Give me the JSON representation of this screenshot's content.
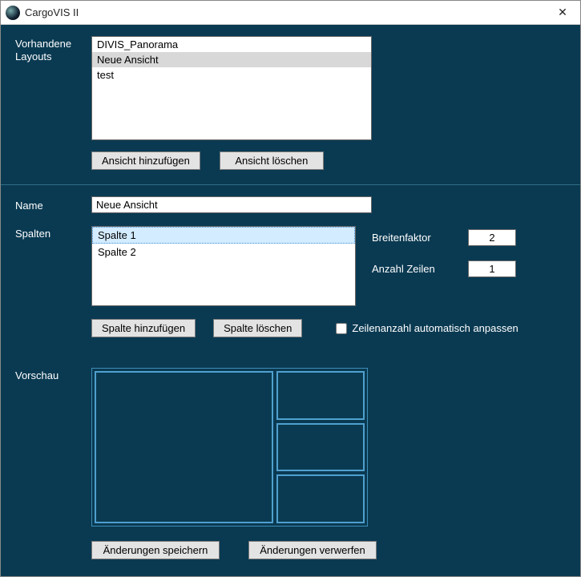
{
  "window": {
    "title": "CargoVIS II"
  },
  "labels": {
    "existing_layouts": "Vorhandene Layouts",
    "name": "Name",
    "columns": "Spalten",
    "preview": "Vorschau",
    "width_factor": "Breitenfaktor",
    "row_count": "Anzahl Zeilen",
    "auto_rows": "Zeilenanzahl automatisch anpassen"
  },
  "buttons": {
    "add_view": "Ansicht hinzufügen",
    "delete_view": "Ansicht löschen",
    "add_column": "Spalte hinzufügen",
    "delete_column": "Spalte löschen",
    "save_changes": "Änderungen speichern",
    "discard_changes": "Änderungen verwerfen"
  },
  "layouts": {
    "items": [
      "DIVIS_Panorama",
      "Neue Ansicht",
      "test"
    ],
    "selected_index": 1
  },
  "form": {
    "name_value": "Neue Ansicht"
  },
  "columns": {
    "items": [
      "Spalte 1",
      "Spalte 2"
    ],
    "selected_index": 0
  },
  "column_props": {
    "width_factor": "2",
    "row_count": "1",
    "auto_rows_checked": false
  }
}
